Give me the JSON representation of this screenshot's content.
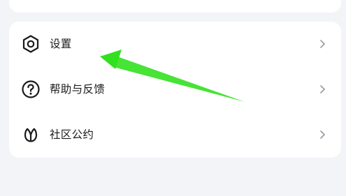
{
  "menu": {
    "items": [
      {
        "label": "设置",
        "icon": "settings-hexagon-icon"
      },
      {
        "label": "帮助与反馈",
        "icon": "help-question-icon"
      },
      {
        "label": "社区公约",
        "icon": "leaf-icon"
      }
    ]
  },
  "colors": {
    "page_background": "#f3f4f8",
    "card_background": "#ffffff",
    "text": "#1a1a1a",
    "chevron": "#9a9a9a",
    "annotation_arrow": "#33e01f"
  }
}
